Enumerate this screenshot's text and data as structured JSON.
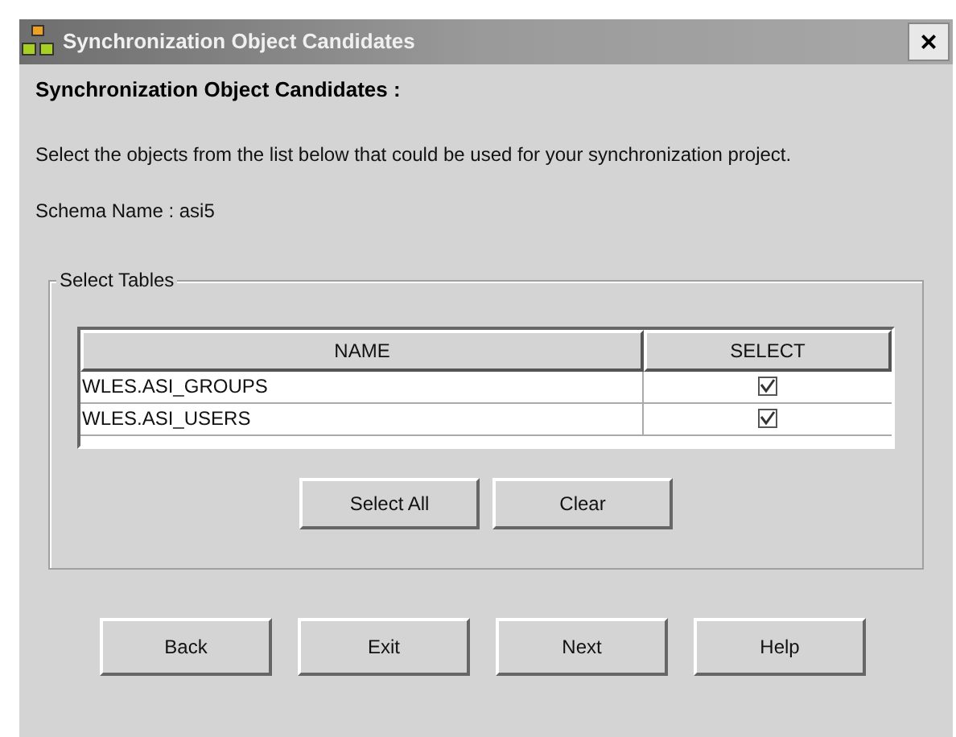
{
  "window": {
    "title": "Synchronization Object Candidates",
    "close": "×"
  },
  "heading": "Synchronization Object Candidates :",
  "description": "Select the objects from the list below that could be used for your synchronization project.",
  "schema": "Schema Name : asi5",
  "group": {
    "title": "Select Tables",
    "table": {
      "columns": [
        "NAME",
        "SELECT"
      ],
      "rows": [
        {
          "name": "WLES.ASI_GROUPS",
          "checked": true
        },
        {
          "name": "WLES.ASI_USERS",
          "checked": true
        }
      ]
    },
    "buttons": [
      "Select All",
      "Clear"
    ]
  },
  "buttons": [
    "Back",
    "Exit",
    "Next",
    "Help"
  ]
}
